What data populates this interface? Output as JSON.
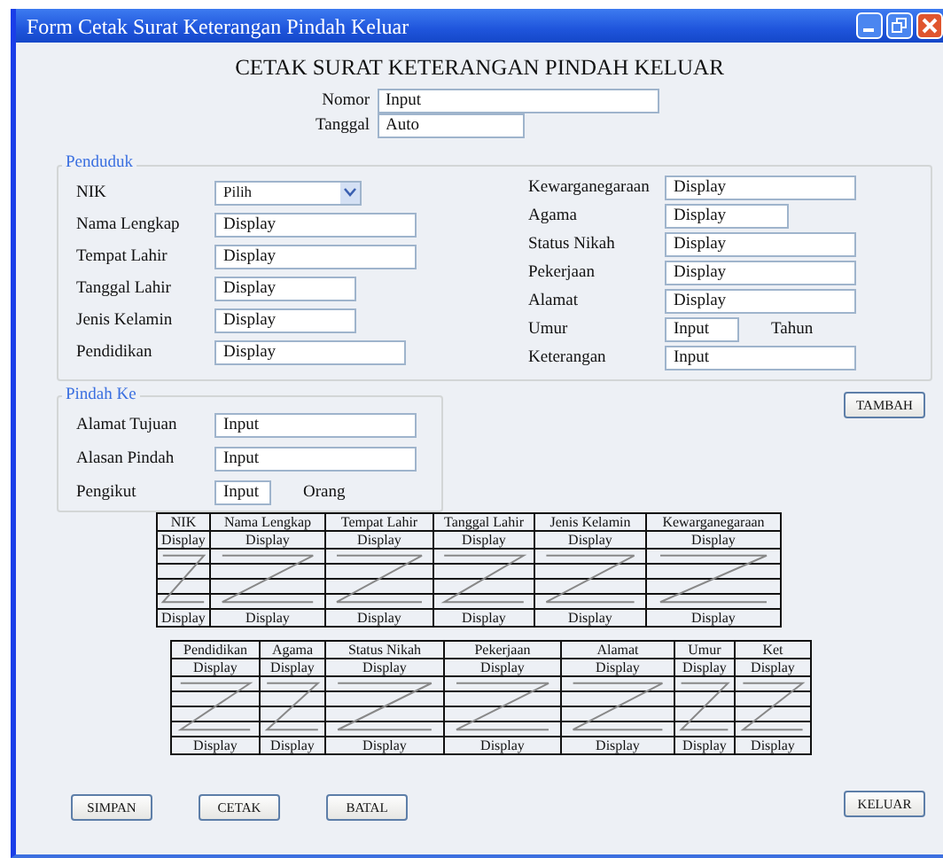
{
  "window": {
    "title": "Form Cetak Surat Keterangan Pindah Keluar"
  },
  "heading": "CETAK SURAT KETERANGAN PINDAH KELUAR",
  "header_fields": [
    {
      "label": "Nomor",
      "value": "Input"
    },
    {
      "label": "Tanggal",
      "value": "Auto"
    }
  ],
  "penduduk": {
    "legend": "Penduduk",
    "left": [
      {
        "label": "NIK",
        "value": "Pilih",
        "kind": "select"
      },
      {
        "label": "Nama Lengkap",
        "value": "Display",
        "kind": "field"
      },
      {
        "label": "Tempat Lahir",
        "value": "Display",
        "kind": "field"
      },
      {
        "label": "Tanggal Lahir",
        "value": "Display",
        "kind": "field"
      },
      {
        "label": "Jenis Kelamin",
        "value": "Display",
        "kind": "field"
      },
      {
        "label": "Pendidikan",
        "value": "Display",
        "kind": "field"
      }
    ],
    "right": [
      {
        "label": "Kewarganegaraan",
        "value": "Display"
      },
      {
        "label": "Agama",
        "value": "Display"
      },
      {
        "label": "Status Nikah",
        "value": "Display"
      },
      {
        "label": "Pekerjaan",
        "value": "Display"
      },
      {
        "label": "Alamat",
        "value": "Display"
      },
      {
        "label": "Umur",
        "value": "Input",
        "suffix": "Tahun"
      },
      {
        "label": "Keterangan",
        "value": "Input"
      }
    ]
  },
  "pindah_ke": {
    "legend": "Pindah Ke",
    "fields": [
      {
        "label": "Alamat Tujuan",
        "value": "Input"
      },
      {
        "label": "Alasan Pindah",
        "value": "Input"
      },
      {
        "label": "Pengikut",
        "value": "Input",
        "suffix": "Orang"
      }
    ]
  },
  "add_button": "TAMBAH",
  "tables": [
    {
      "columns": [
        "NIK",
        "Nama Lengkap",
        "Tempat Lahir",
        "Tanggal Lahir",
        "Jenis Kelamin",
        "Kewarganegaraan"
      ],
      "first_row": [
        "Display",
        "Display",
        "Display",
        "Display",
        "Display",
        "Display"
      ],
      "last_row": [
        "Display",
        "Display",
        "Display",
        "Display",
        "Display",
        "Display"
      ]
    },
    {
      "columns": [
        "Pendidikan",
        "Agama",
        "Status Nikah",
        "Pekerjaan",
        "Alamat",
        "Umur",
        "Ket"
      ],
      "first_row": [
        "Display",
        "Display",
        "Display",
        "Display",
        "Display",
        "Display",
        "Display"
      ],
      "last_row": [
        "Display",
        "Display",
        "Display",
        "Display",
        "Display",
        "Display",
        "Display"
      ]
    }
  ],
  "buttons": [
    "SIMPAN",
    "CETAK",
    "BATAL"
  ],
  "exit_button": "KELUAR"
}
